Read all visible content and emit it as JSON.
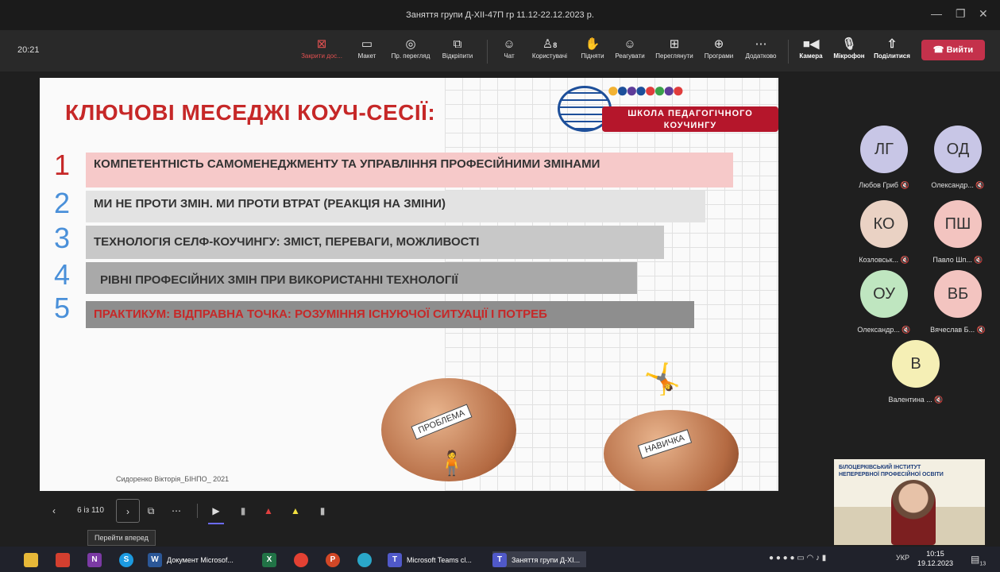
{
  "window": {
    "title": "Заняття групи Д-XII-47П гр 11.12-22.12.2023 р."
  },
  "meeting": {
    "elapsed": "20:21"
  },
  "toolbar": {
    "stop_share": "Закрити дос...",
    "layout": "Макет",
    "preview": "Пр. перегляд",
    "popout": "Відкріпити",
    "chat": "Чат",
    "people": "Користувачі",
    "people_count": "8",
    "raise": "Підняти",
    "react": "Реагувати",
    "view": "Переглянути",
    "apps": "Програми",
    "more": "Додатково",
    "camera": "Камера",
    "mic": "Мікрофон",
    "share": "Поділитися",
    "leave": "Вийти"
  },
  "slide": {
    "title": "КЛЮЧОВІ МЕСЕДЖІ КОУЧ-СЕСІЇ:",
    "logo_text_line1": "ШКОЛА ПЕДАГОГІЧНОГО",
    "logo_text_line2": "КОУЧИНГУ",
    "items": [
      {
        "num": "1",
        "text": "КОМПЕТЕНТНІСТЬ САМОМЕНЕДЖМЕНТУ ТА УПРАВЛІННЯ ПРОФЕСІЙНИМИ ЗМІНАМИ",
        "num_color": "#c62828",
        "bar_color": "#f6c9c9",
        "text_color": "#333333"
      },
      {
        "num": "2",
        "text": "МИ НЕ ПРОТИ ЗМІН. МИ ПРОТИ ВТРАТ (РЕАКЦІЯ НА ЗМІНИ)",
        "num_color": "#4a90d9",
        "bar_color": "#e3e3e3",
        "text_color": "#333333"
      },
      {
        "num": "3",
        "text": "ТЕХНОЛОГІЯ СЕЛФ-КОУЧИНГУ: ЗМІСТ, ПЕРЕВАГИ, МОЖЛИВОСТІ",
        "num_color": "#4a90d9",
        "bar_color": "#c8c8c8",
        "text_color": "#333333"
      },
      {
        "num": "4",
        "text": "РІВНІ ПРОФЕСІЙНИХ ЗМІН ПРИ ВИКОРИСТАННІ  ТЕХНОЛОГІЇ",
        "num_color": "#4a90d9",
        "bar_color": "#a9a9a9",
        "text_color": "#333333"
      },
      {
        "num": "5",
        "text": "ПРАКТИКУМ: ВІДПРАВНА ТОЧКА: РОЗУМІННЯ ІСНУЮЧОЇ СИТУАЦІЇ І ПОТРЕБ",
        "num_color": "#4a90d9",
        "bar_color": "#8e8e8e",
        "text_color": "#c62828"
      }
    ],
    "ball1_label": "ПРОБЛЕМА",
    "ball2_label": "НАВИЧКА",
    "author": "Сидоренко Вікторія_БІНПО_ 2021"
  },
  "participants": [
    {
      "initials": "ЛГ",
      "name": "Любов Гриб",
      "color": "#c8c6e6"
    },
    {
      "initials": "ОД",
      "name": "Олександр...",
      "color": "#c8c6e6"
    },
    {
      "initials": "КО",
      "name": "Козловськ...",
      "color": "#ead2c4"
    },
    {
      "initials": "ПШ",
      "name": "Павло Шп...",
      "color": "#f3c4c0"
    },
    {
      "initials": "ОУ",
      "name": "Олександр...",
      "color": "#bfe6c0"
    },
    {
      "initials": "ВБ",
      "name": "Вячеслав Б...",
      "color": "#f3c4c0"
    },
    {
      "initials": "В",
      "name": "Валентина ...",
      "color": "#f5efb5"
    }
  ],
  "video": {
    "board_line1": "БІЛОЦЕРКІВСЬКИЙ ІНСТИТУТ",
    "board_line2": "НЕПЕРЕРВНОЇ ПРОФЕСІЙНОЇ ОСВІТИ"
  },
  "slide_nav": {
    "counter": "6 із 110",
    "tooltip": "Перейти вперед"
  },
  "taskbar": {
    "word": "Документ Microsof...",
    "teams1": "Microsoft Teams cl...",
    "teams2": "Заняття групи Д-XI...",
    "lang": "УКР",
    "time": "10:15",
    "date": "19.12.2023",
    "notif": "13"
  }
}
